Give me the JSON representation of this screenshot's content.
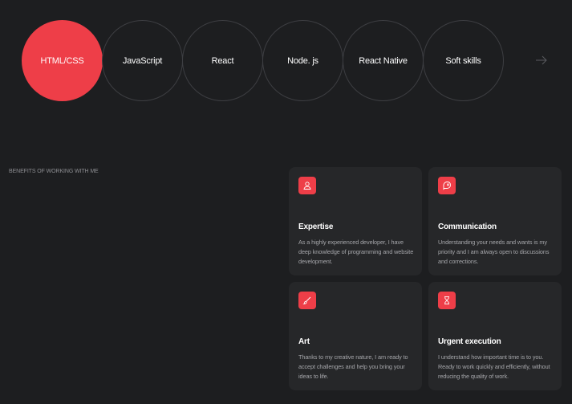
{
  "colors": {
    "accent": "#ee3e48",
    "background": "#1d1e20",
    "card": "#262729"
  },
  "skills": {
    "items": [
      {
        "label": "HTML/CSS",
        "active": true
      },
      {
        "label": "JavaScript",
        "active": false
      },
      {
        "label": "React",
        "active": false
      },
      {
        "label": "Node. js",
        "active": false
      },
      {
        "label": "React Native",
        "active": false
      },
      {
        "label": "Soft skills",
        "active": false
      }
    ],
    "next_icon": "arrow-right-icon"
  },
  "benefits": {
    "section_label": "BENEFITS OF WORKING WITH ME",
    "cards": [
      {
        "icon": "user-icon",
        "title": "Expertise",
        "description": "As a highly experienced developer, I have deep knowledge of programming and website development."
      },
      {
        "icon": "chat-icon",
        "title": "Communication",
        "description": " Understanding your needs and wants is my priority and I am always open to discussions and corrections."
      },
      {
        "icon": "brush-icon",
        "title": "Art",
        "description": "Thanks to my creative nature, I am ready to accept challenges and help you bring your ideas to life."
      },
      {
        "icon": "hourglass-icon",
        "title": "Urgent execution",
        "description": "I understand how important time is to you. Ready to work quickly and efficiently, without reducing the quality of work."
      }
    ]
  }
}
